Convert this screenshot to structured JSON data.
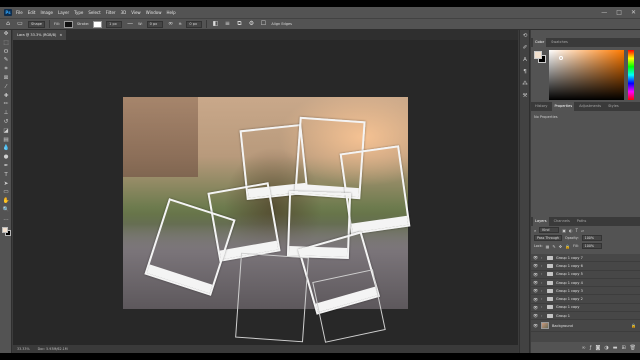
{
  "menubar": {
    "logo": "Ps",
    "items": [
      "File",
      "Edit",
      "Image",
      "Layer",
      "Type",
      "Select",
      "Filter",
      "3D",
      "View",
      "Window",
      "Help"
    ],
    "controls": [
      "—",
      "□",
      "✕"
    ]
  },
  "options": {
    "mode": "Shape",
    "fill_label": "Fill:",
    "stroke_label": "Stroke:",
    "stroke_width": "1 px",
    "w_label": "W:",
    "w_value": "0 px",
    "h_label": "H:",
    "h_value": "0 px",
    "align_edges": "Align Edges",
    "fill_color": "#111111",
    "stroke_color": "#ffffff"
  },
  "document": {
    "tab_title": "Lara @ 33.3% (RGB/8)",
    "tab_close": "×",
    "zoom": "33.33%",
    "doc_info": "Doc: 5.93M/62.1M"
  },
  "tools": [
    "move-tool",
    "marquee-tool",
    "lasso-tool",
    "quick-select-tool",
    "crop-tool",
    "frame-tool",
    "eyedropper-tool",
    "spot-healing-tool",
    "brush-tool",
    "clone-stamp-tool",
    "history-brush-tool",
    "eraser-tool",
    "gradient-tool",
    "blur-tool",
    "dodge-tool",
    "pen-tool",
    "type-tool",
    "path-select-tool",
    "rectangle-tool",
    "hand-tool",
    "zoom-tool",
    "edit-toolbar"
  ],
  "panels": {
    "color_tabs": [
      "Color",
      "Swatches"
    ],
    "colors": {
      "foreground": "#f2e1cf",
      "background": "#000000"
    },
    "props_tabs": [
      "History",
      "Properties",
      "Adjustments",
      "Styles"
    ],
    "props_empty": "No Properties",
    "layers_tabs": [
      "Layers",
      "Channels",
      "Paths"
    ],
    "kind": "Kind",
    "blend_mode": "Pass Through",
    "opacity_label": "Opacity:",
    "opacity_value": "100%",
    "lock_label": "Lock:",
    "fill_label": "Fill:",
    "fill_value": "100%"
  },
  "layers": [
    {
      "name": "Group 1 copy 7",
      "type": "group"
    },
    {
      "name": "Group 1 copy 6",
      "type": "group"
    },
    {
      "name": "Group 1 copy 5",
      "type": "group"
    },
    {
      "name": "Group 1 copy 4",
      "type": "group"
    },
    {
      "name": "Group 1 copy 3",
      "type": "group"
    },
    {
      "name": "Group 1 copy 2",
      "type": "group"
    },
    {
      "name": "Group 1 copy",
      "type": "group"
    },
    {
      "name": "Group 1",
      "type": "group"
    },
    {
      "name": "Background",
      "type": "background"
    }
  ],
  "layers_footer": [
    "link-icon",
    "fx-icon",
    "mask-icon",
    "adjustment-icon",
    "new-group-icon",
    "new-layer-icon",
    "trash-icon"
  ]
}
